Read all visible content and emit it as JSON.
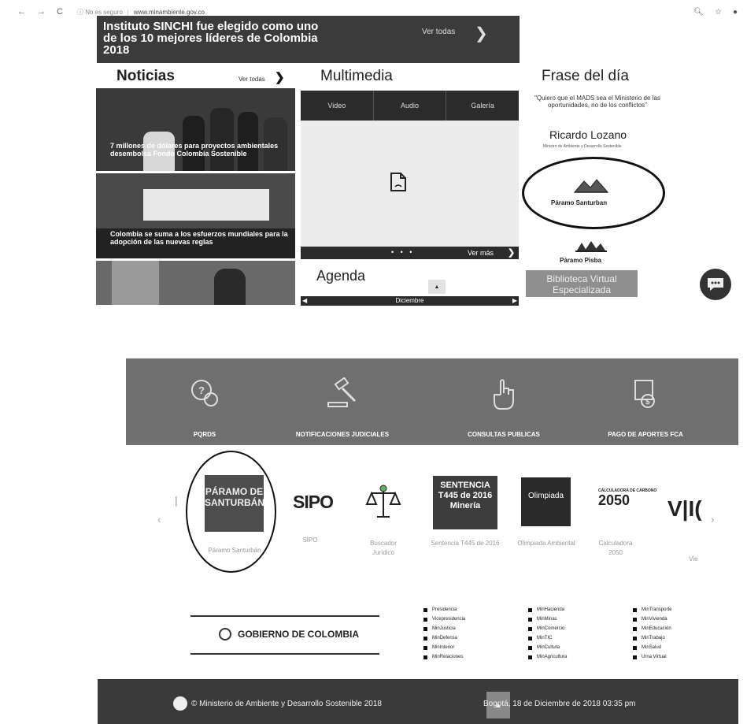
{
  "browser": {
    "nav_back": "←",
    "nav_forward": "→",
    "reload": "C",
    "info": "ⓘ",
    "security": "No es seguro",
    "url": "www.minambiente.gov.co",
    "icons": [
      "zoom-icon",
      "star-icon",
      "account-icon"
    ]
  },
  "hero": {
    "title": "Instituto SINCHI fue elegido como uno de los 10 mejores líderes de Colombia 2018",
    "link": "Ver todas"
  },
  "news": {
    "heading": "Noticias",
    "view_all": "Ver todas",
    "items": [
      {
        "caption": "7 millones de dólares para proyectos ambientales desembolsa Fondo Colombia Sostenible"
      },
      {
        "caption": "Colombia se suma a los esfuerzos mundiales para la adopción de las nuevas reglas"
      }
    ]
  },
  "multimedia": {
    "heading": "Multimedia",
    "tabs": [
      "Video",
      "Audio",
      "Galería"
    ],
    "dots": "• • •",
    "more": "Ver más"
  },
  "agenda": {
    "heading": "Agenda",
    "up": "▲",
    "month": "Diciembre"
  },
  "frase": {
    "heading": "Frase del día",
    "quote": "\"Quiero que el MADS sea el Ministerio de las oportunidades, no de los conflictos\"",
    "author": "Ricardo Lozano",
    "role": "Ministro de Ambiente y Desarrollo Sostenible",
    "paramo1": "Páramo Santurban",
    "paramo2": "Páramo Pisba",
    "biblioteca": "Biblioteca Virtual Especializada"
  },
  "services": [
    {
      "label": "PQRDS",
      "icon": "chat-question-icon"
    },
    {
      "label": "NOTIFICACIONES JUDICIALES",
      "icon": "gavel-icon"
    },
    {
      "label": "CONSULTAS PUBLICAS",
      "icon": "hand-pointer-icon"
    },
    {
      "label": "PAGO DE APORTES FCA",
      "icon": "payment-icon"
    }
  ],
  "carousel": {
    "prev": "‹",
    "next": "›",
    "items": [
      {
        "label": "Páramo Santurbán",
        "image_text": "PÁRAMO DE SANTURBÁN"
      },
      {
        "label": "SIPO",
        "image_text": "SIPO"
      },
      {
        "label": "Buscador Jurídico"
      },
      {
        "label": "Sentencia T445 de 2016",
        "image_text": "SENTENCIA T445 de 2016 Minería"
      },
      {
        "label": "Olimpiada Ambiental",
        "image_text": "Olimpiada"
      },
      {
        "label": "Calculadora 2050",
        "image_text_small": "CALCULADORA DE CARBONO",
        "image_text": "2050"
      },
      {
        "label": "Vie",
        "image_text": "V|I("
      }
    ]
  },
  "gobierno": {
    "label": "GOBIERNO DE COLOMBIA",
    "col1": [
      "Presidencia",
      "Vicepresidencia",
      "MinJusticia",
      "MinDefensa",
      "MinInterior",
      "MinRelaciones"
    ],
    "col2": [
      "MinHacienda",
      "MinMinas",
      "MinComercio",
      "MinTIC",
      "MinCultura",
      "MinAgricultura"
    ],
    "col3": [
      "MinTransporte",
      "MinVivienda",
      "MinEducación",
      "MinTrabajo",
      "MinSalud",
      "Urna Virtual"
    ]
  },
  "footer": {
    "copyright": "© Ministerio de Ambiente y Desarrollo Sostenible 2018",
    "datetime": "Bogotá, 18 de Diciembre de 2018 03:35 pm",
    "up": "▲"
  }
}
